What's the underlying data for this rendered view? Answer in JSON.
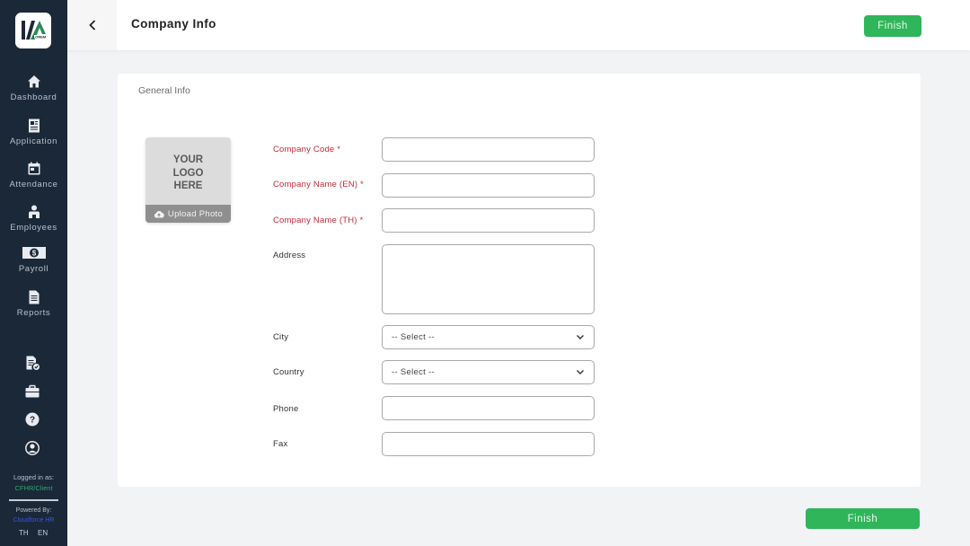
{
  "app": {
    "logo_text": "LOREM",
    "brand_color": "#1b2838",
    "accent_color": "#2fb55a"
  },
  "sidebar": {
    "nav_items": [
      {
        "label": "Dashboard",
        "icon": "home-icon"
      },
      {
        "label": "Application",
        "icon": "application-icon"
      },
      {
        "label": "Attendance",
        "icon": "calendar-icon"
      },
      {
        "label": "Employees",
        "icon": "employee-icon"
      },
      {
        "label": "Payroll",
        "icon": "payroll-icon"
      },
      {
        "label": "Reports",
        "icon": "reports-icon"
      }
    ],
    "utility_icons": [
      "approval-icon",
      "briefcase-icon",
      "help-icon",
      "user-profile-icon"
    ],
    "logged_in_label": "Logged in as:",
    "logged_in_user": "CFHR/Client",
    "powered_by_label": "Powered By:",
    "powered_by_brand": "Cloudforce HR",
    "languages": [
      "TH",
      "EN"
    ]
  },
  "header": {
    "title": "Company Info",
    "finish_label": "Finish"
  },
  "form": {
    "section_title": "General Info",
    "logo_placeholder": [
      "YOUR",
      "LOGO",
      "HERE"
    ],
    "upload_label": "Upload Photo",
    "fields": {
      "company_code": {
        "label": "Company Code *",
        "value": "",
        "required": true
      },
      "company_name_en": {
        "label": "Company Name (EN) *",
        "value": "",
        "required": true
      },
      "company_name_th": {
        "label": "Company Name (TH) *",
        "value": "",
        "required": true
      },
      "address": {
        "label": "Address",
        "value": ""
      },
      "city": {
        "label": "City",
        "selected": "-- Select --"
      },
      "country": {
        "label": "Country",
        "selected": "-- Select --"
      },
      "phone": {
        "label": "Phone",
        "value": ""
      },
      "fax": {
        "label": "Fax",
        "value": ""
      }
    }
  },
  "footer": {
    "finish_label": "Finish"
  }
}
